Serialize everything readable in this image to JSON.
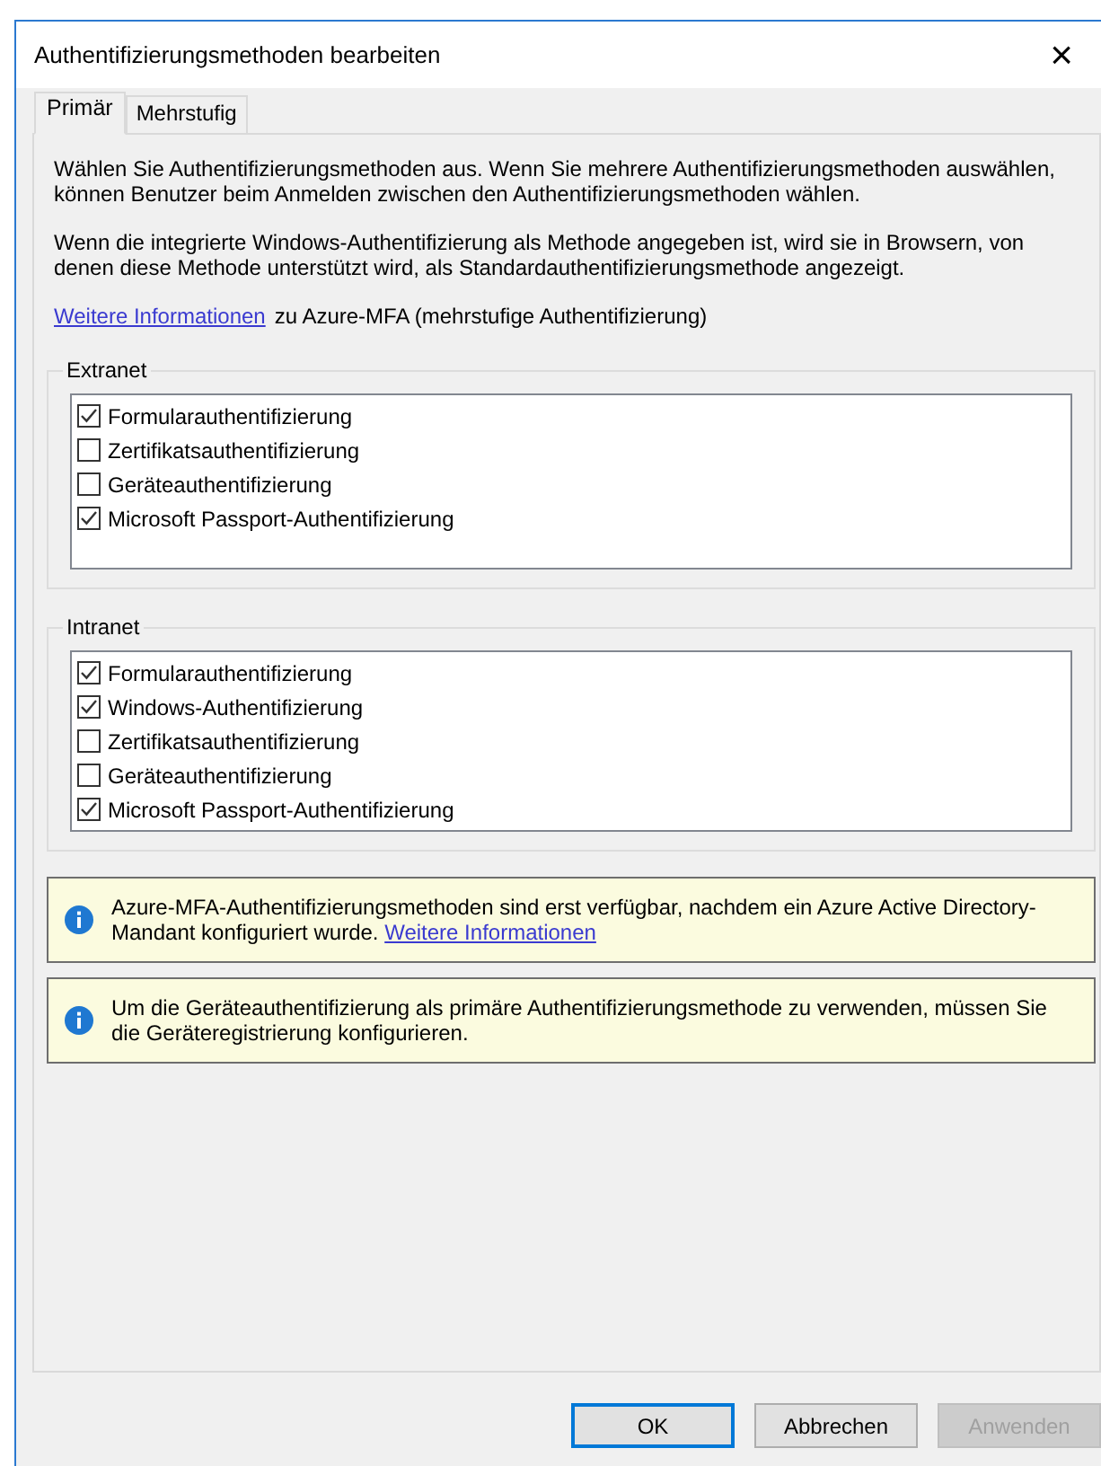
{
  "window": {
    "title": "Authentifizierungsmethoden bearbeiten",
    "close": "×"
  },
  "tabs": [
    {
      "label": "Primär",
      "selected": true
    },
    {
      "label": "Mehrstufig",
      "selected": false
    }
  ],
  "intro": [
    "Wählen Sie Authentifizierungsmethoden aus. Wenn Sie mehrere Authentifizierungsmethoden auswählen, können Benutzer beim Anmelden zwischen den Authentifizierungsmethoden wählen.",
    "Wenn die integrierte Windows-Authentifizierung als Methode angegeben ist, wird sie in Browsern, von denen diese Methode unterstützt wird, als Standardauthentifizierungsmethode angezeigt."
  ],
  "more_info": {
    "link": "Weitere Informationen",
    "text": "zu Azure-MFA (mehrstufige Authentifizierung)"
  },
  "groups": [
    {
      "title": "Extranet",
      "items": [
        {
          "label": "Formularauthentifizierung",
          "checked": true
        },
        {
          "label": "Zertifikatsauthentifizierung",
          "checked": false
        },
        {
          "label": "Geräteauthentifizierung",
          "checked": false
        },
        {
          "label": "Microsoft Passport-Authentifizierung",
          "checked": true
        }
      ]
    },
    {
      "title": "Intranet",
      "items": [
        {
          "label": "Formularauthentifizierung",
          "checked": true
        },
        {
          "label": "Windows-Authentifizierung",
          "checked": true
        },
        {
          "label": "Zertifikatsauthentifizierung",
          "checked": false
        },
        {
          "label": "Geräteauthentifizierung",
          "checked": false
        },
        {
          "label": "Microsoft Passport-Authentifizierung",
          "checked": true
        }
      ]
    }
  ],
  "notices": [
    {
      "text": "Azure-MFA-Authentifizierungsmethoden sind erst verfügbar, nachdem ein Azure Active Directory-Mandant konfiguriert wurde.",
      "link": "Weitere Informationen"
    },
    {
      "text": "Um die Geräteauthentifizierung als primäre Authentifizierungsmethode zu verwenden, müssen Sie die Geräteregistrierung konfigurieren."
    }
  ],
  "buttons": [
    {
      "label": "OK",
      "default": true,
      "disabled": false
    },
    {
      "label": "Abbrechen",
      "default": false,
      "disabled": false
    },
    {
      "label": "Anwenden",
      "default": false,
      "disabled": true
    }
  ]
}
